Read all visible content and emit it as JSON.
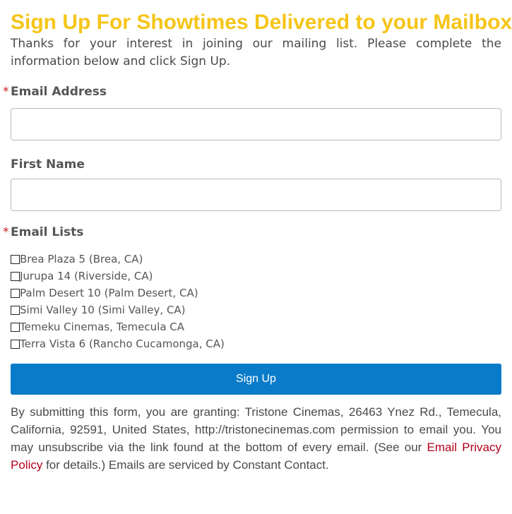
{
  "title": "Sign Up For Showtimes Delivered to your Mailbox!",
  "intro": "Thanks for your interest in joining our mailing list. Please complete the information below and click Sign Up.",
  "required_mark": "*",
  "email": {
    "label": "Email Address",
    "value": "",
    "placeholder": ""
  },
  "first_name": {
    "label": "First Name",
    "value": "",
    "placeholder": ""
  },
  "lists": {
    "label": "Email Lists",
    "items": [
      {
        "label": "Brea Plaza 5 (Brea, CA)",
        "checked": false
      },
      {
        "label": "Jurupa 14 (Riverside, CA)",
        "checked": false
      },
      {
        "label": "Palm Desert 10 (Palm Desert, CA)",
        "checked": false
      },
      {
        "label": "Simi Valley 10 (Simi Valley, CA)",
        "checked": false
      },
      {
        "label": "Temeku Cinemas, Temecula CA",
        "checked": false
      },
      {
        "label": "Terra Vista 6 (Rancho Cucamonga, CA)",
        "checked": false
      }
    ]
  },
  "submit_label": "Sign Up",
  "legal": {
    "before_link": "By submitting this form, you are granting: Tristone Cinemas, 26463 Ynez Rd., Temecula, California, 92591, United States, http://tristonecinemas.com permission to email you. You may unsubscribe via the link found at the bottom of every email. (See our ",
    "link_text": "Email Privacy Policy",
    "after_link": " for details.) Emails are serviced by Constant Contact."
  },
  "colors": {
    "title": "#f5c518",
    "button": "#0a7bc8",
    "required": "#cc2020",
    "link": "#b3001b"
  }
}
